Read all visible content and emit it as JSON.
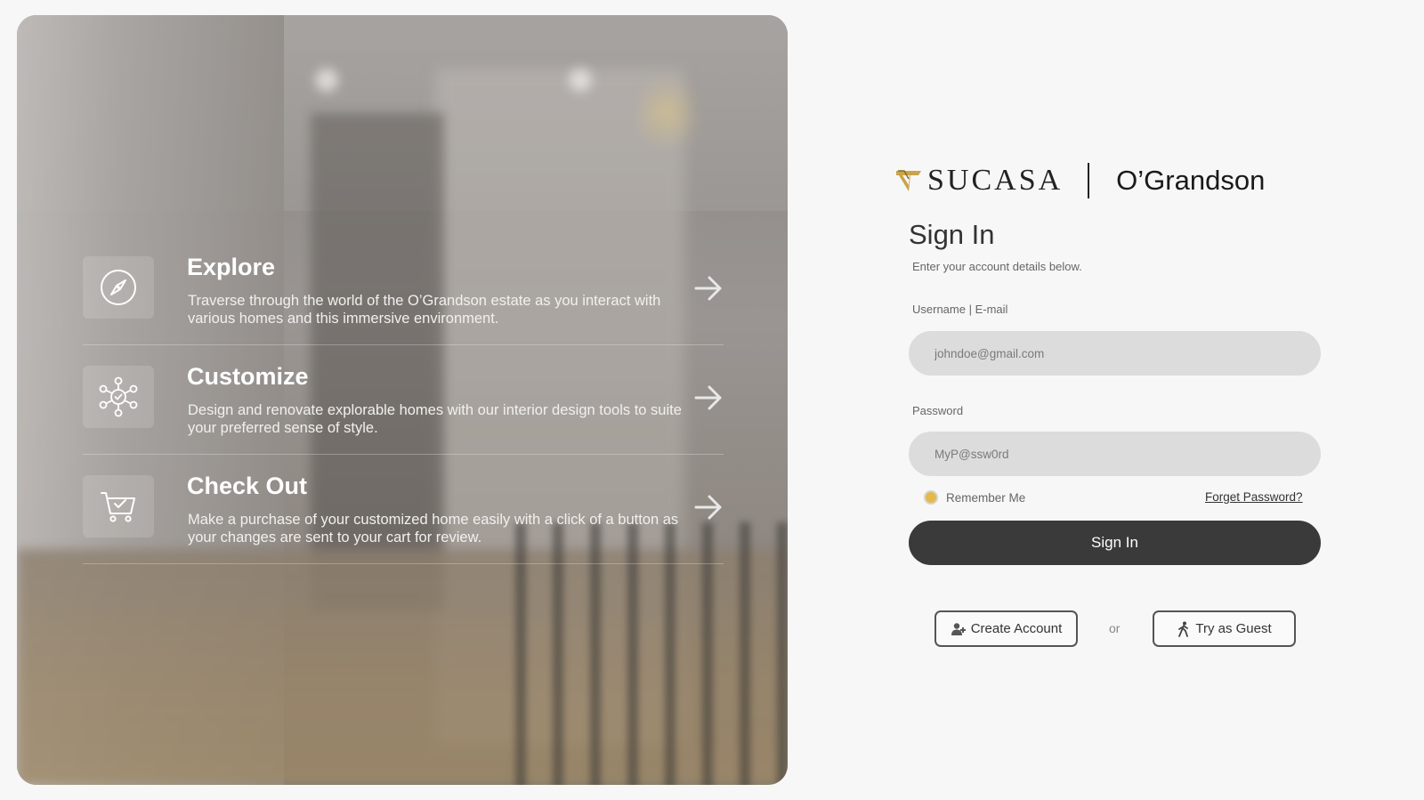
{
  "features": [
    {
      "title": "Explore",
      "description": "Traverse through the world of the O’Grandson estate as you interact with various homes and this immersive environment.",
      "icon": "compass-icon"
    },
    {
      "title": "Customize",
      "description": "Design and renovate explorable homes with our interior design tools to suite your preferred sense of style.",
      "icon": "network-check-icon"
    },
    {
      "title": "Check Out",
      "description": "Make a purchase of your customized home easily with a click of a button as your changes are sent to your cart for review.",
      "icon": "cart-check-icon"
    }
  ],
  "brand": {
    "logo_text": "SUCASA",
    "partner": "O’Grandson",
    "accent_color": "#c9a44a"
  },
  "signin": {
    "title": "Sign In",
    "subtitle": "Enter your account details below.",
    "username_label": "Username | E-mail",
    "username_placeholder": "johndoe@gmail.com",
    "password_label": "Password",
    "password_placeholder": "MyP@ssw0rd",
    "remember_label": "Remember Me",
    "forgot_label": "Forget Password?",
    "submit_label": "Sign In",
    "create_label": "Create Account",
    "or_label": "or",
    "guest_label": "Try as Guest"
  }
}
